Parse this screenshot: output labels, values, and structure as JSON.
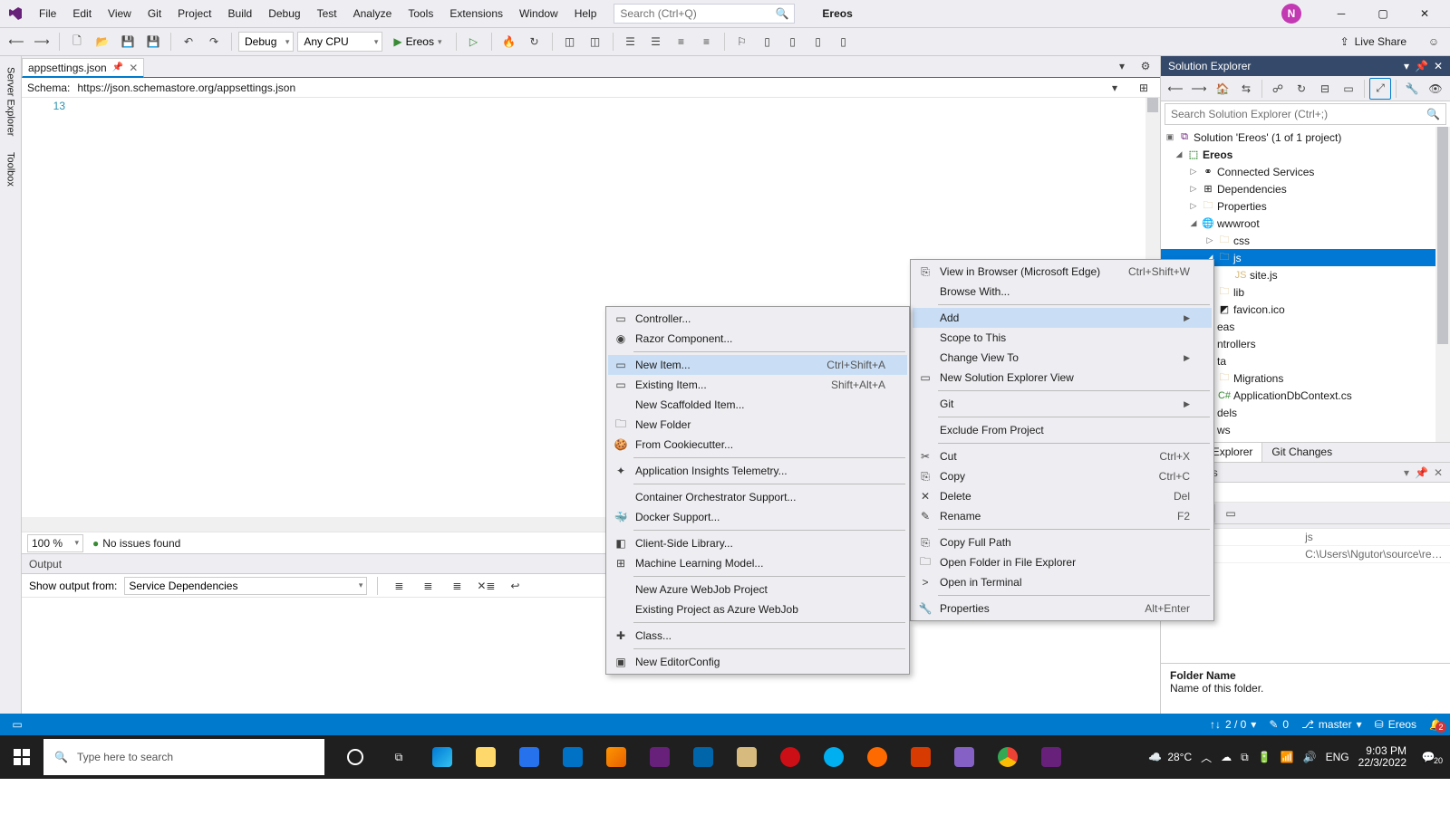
{
  "menu": [
    "File",
    "Edit",
    "View",
    "Git",
    "Project",
    "Build",
    "Debug",
    "Test",
    "Analyze",
    "Tools",
    "Extensions",
    "Window",
    "Help"
  ],
  "search_placeholder": "Search (Ctrl+Q)",
  "solution_name": "Ereos",
  "avatar_initial": "N",
  "toolbar": {
    "config": "Debug",
    "platform": "Any CPU",
    "start_target": "Ereos",
    "live_share": "Live Share"
  },
  "rail": [
    "Server Explorer",
    "Toolbox"
  ],
  "doc_tab": {
    "name": "appsettings.json"
  },
  "schema_label": "Schema:",
  "schema_url": "https://json.schemastore.org/appsettings.json",
  "line_number": "13",
  "zoom": "100 %",
  "issues_text": "No issues found",
  "output": {
    "title": "Output",
    "from_label": "Show output from:",
    "from_value": "Service Dependencies"
  },
  "se": {
    "title": "Solution Explorer",
    "search_placeholder": "Search Solution Explorer (Ctrl+;)",
    "nodes": {
      "solution": "Solution 'Ereos' (1 of 1 project)",
      "project": "Ereos",
      "connected": "Connected Services",
      "deps": "Dependencies",
      "props": "Properties",
      "wwwroot": "wwwroot",
      "css": "css",
      "js": "js",
      "sitejs": "site.js",
      "lib": "lib",
      "favicon": "favicon.ico",
      "areas": "eas",
      "controllers": "ntrollers",
      "data": "ta",
      "migrations": "Migrations",
      "appdb": "ApplicationDbContext.cs",
      "models": "dels",
      "views": "ws"
    },
    "tabs": [
      "Solution Explorer",
      "Git Changes"
    ]
  },
  "props": {
    "title": "Properties",
    "subject": "",
    "category": "",
    "rows": [
      {
        "k": "",
        "v": "js"
      },
      {
        "k": "",
        "v": "C:\\Users\\Ngutor\\source\\repos\\Er"
      }
    ],
    "desc_title": "Folder Name",
    "desc_body": "Name of this folder."
  },
  "ctx_main": [
    {
      "label": "View in Browser (Microsoft Edge)",
      "sc": "Ctrl+Shift+W",
      "ic": "⎘"
    },
    {
      "label": "Browse With..."
    },
    {
      "sep": true
    },
    {
      "label": "Add",
      "submenu": true,
      "hover": true
    },
    {
      "label": "Scope to This"
    },
    {
      "label": "Change View To",
      "submenu": true
    },
    {
      "label": "New Solution Explorer View",
      "ic": "▭"
    },
    {
      "sep": true
    },
    {
      "label": "Git",
      "submenu": true
    },
    {
      "sep": true
    },
    {
      "label": "Exclude From Project"
    },
    {
      "sep": true
    },
    {
      "label": "Cut",
      "sc": "Ctrl+X",
      "ic": "✂"
    },
    {
      "label": "Copy",
      "sc": "Ctrl+C",
      "ic": "⎘"
    },
    {
      "label": "Delete",
      "sc": "Del",
      "ic": "✕"
    },
    {
      "label": "Rename",
      "sc": "F2",
      "ic": "✎"
    },
    {
      "sep": true
    },
    {
      "label": "Copy Full Path",
      "ic": "⎘"
    },
    {
      "label": "Open Folder in File Explorer",
      "ic": "🗀"
    },
    {
      "label": "Open in Terminal",
      "ic": ">"
    },
    {
      "sep": true
    },
    {
      "label": "Properties",
      "sc": "Alt+Enter",
      "ic": "🔧"
    }
  ],
  "ctx_add": [
    {
      "label": "Controller...",
      "ic": "▭"
    },
    {
      "label": "Razor Component...",
      "ic": "◉"
    },
    {
      "sep": true
    },
    {
      "label": "New Item...",
      "sc": "Ctrl+Shift+A",
      "ic": "▭",
      "hover": true
    },
    {
      "label": "Existing Item...",
      "sc": "Shift+Alt+A",
      "ic": "▭"
    },
    {
      "label": "New Scaffolded Item..."
    },
    {
      "label": "New Folder",
      "ic": "🗀"
    },
    {
      "label": "From Cookiecutter...",
      "ic": "🍪"
    },
    {
      "sep": true
    },
    {
      "label": "Application Insights Telemetry...",
      "ic": "✦"
    },
    {
      "sep": true
    },
    {
      "label": "Container Orchestrator Support..."
    },
    {
      "label": "Docker Support...",
      "ic": "🐳"
    },
    {
      "sep": true
    },
    {
      "label": "Client-Side Library...",
      "ic": "◧"
    },
    {
      "label": "Machine Learning Model...",
      "ic": "⊞"
    },
    {
      "sep": true
    },
    {
      "label": "New Azure WebJob Project"
    },
    {
      "label": "Existing Project as Azure WebJob"
    },
    {
      "sep": true
    },
    {
      "label": "Class...",
      "ic": "✚"
    },
    {
      "sep": true
    },
    {
      "label": "New EditorConfig",
      "ic": "▣"
    }
  ],
  "status": {
    "changes": "2 / 0",
    "commits": "0",
    "branch": "master",
    "repo": "Ereos",
    "bell_count": "2"
  },
  "taskbar": {
    "search_placeholder": "Type here to search",
    "weather_temp": "28°C",
    "time": "9:03 PM",
    "date": "22/3/2022",
    "notif_count": "20"
  }
}
